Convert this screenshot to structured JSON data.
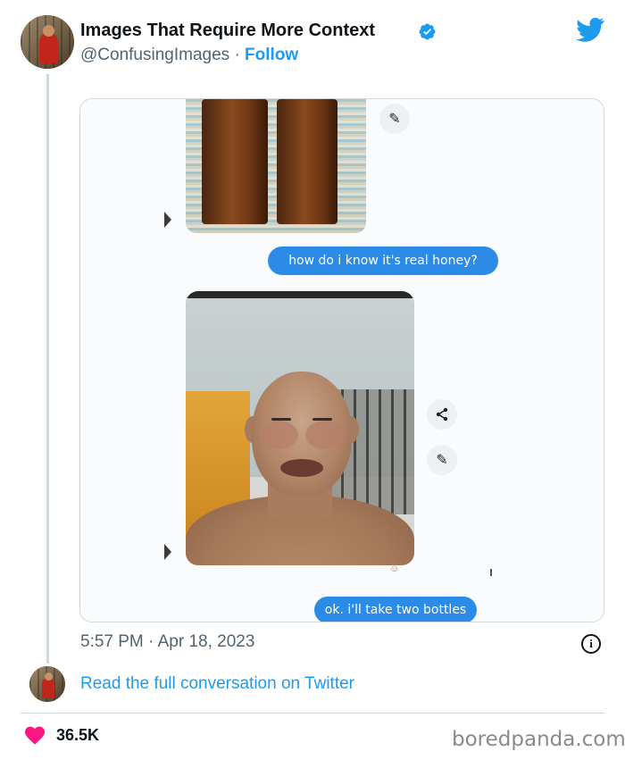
{
  "tweet": {
    "author_name": "Images That Require More Context",
    "handle": "@ConfusingImages",
    "separator": "·",
    "follow_label": "Follow",
    "timestamp": "5:57 PM · Apr 18, 2023",
    "read_more_label": "Read the full conversation on Twitter",
    "likes": "36.5K"
  },
  "media": {
    "message_1": "how do i know it's real honey?",
    "message_2": "ok. i'll take two bottles"
  },
  "icons": {
    "verified": "verified-badge-icon",
    "twitter": "twitter-bird-icon",
    "info": "info-icon",
    "heart": "heart-icon",
    "share": "share-icon",
    "edit": "pencil-icon",
    "play": "play-icon"
  },
  "colors": {
    "twitter_blue": "#1d9bf0",
    "bubble_blue": "#2b8be6",
    "heart_pink": "#f91880",
    "muted_text": "#536471"
  },
  "footer": {
    "watermark": "boredpanda.com"
  }
}
